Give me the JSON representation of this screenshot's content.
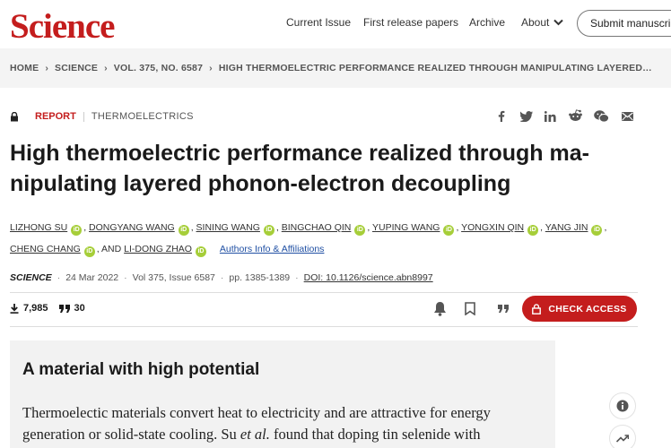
{
  "header": {
    "logo": "Science",
    "nav": [
      "Current Issue",
      "First release papers",
      "Archive",
      "About"
    ],
    "submit": "Submit manuscript"
  },
  "breadcrumb": [
    "HOME",
    "SCIENCE",
    "VOL. 375, NO. 6587",
    "HIGH THERMOELECTRIC PERFORMANCE REALIZED THROUGH MANIPULATING LAYERED…"
  ],
  "article": {
    "type": "REPORT",
    "subject": "THERMOELECTRICS",
    "title": "High thermoelectric performance realized through ma-nipulating layered phonon-electron decoupling",
    "authors_line1": [
      "LIZHONG SU",
      "DONGYANG WANG",
      "SINING WANG",
      "BINGCHAO QIN",
      "YUPING WANG",
      "YONGXIN QIN",
      "YANG JIN"
    ],
    "authors_line2": [
      "CHENG CHANG",
      "LI-DONG ZHAO"
    ],
    "and_text": ", AND",
    "affiliations_link": "Authors Info & Affiliations",
    "journal": "SCIENCE",
    "date": "24 Mar 2022",
    "volume": "Vol 375, Issue 6587",
    "pages": "pp. 1385-1389",
    "doi": "DOI: 10.1126/science.abn8997",
    "downloads": "7,985",
    "citations": "30",
    "check_access": "CHECK ACCESS"
  },
  "abstract": {
    "title": "A material with high potential",
    "text_part1": "Thermoelectic materials convert heat to electricity and are attractive for energy generation or solid-state cooling. Su ",
    "text_italic": "et al.",
    "text_part2": " found that doping tin selenide with"
  },
  "colors": {
    "brand": "#c41d1d",
    "orcid": "#a6ce39",
    "link": "#1f4fa3"
  },
  "icons": [
    "lock-icon",
    "facebook-icon",
    "twitter-icon",
    "linkedin-icon",
    "reddit-icon",
    "wechat-icon",
    "email-icon",
    "download-icon",
    "quote-icon",
    "bell-icon",
    "bookmark-icon",
    "info-icon",
    "trending-icon"
  ]
}
